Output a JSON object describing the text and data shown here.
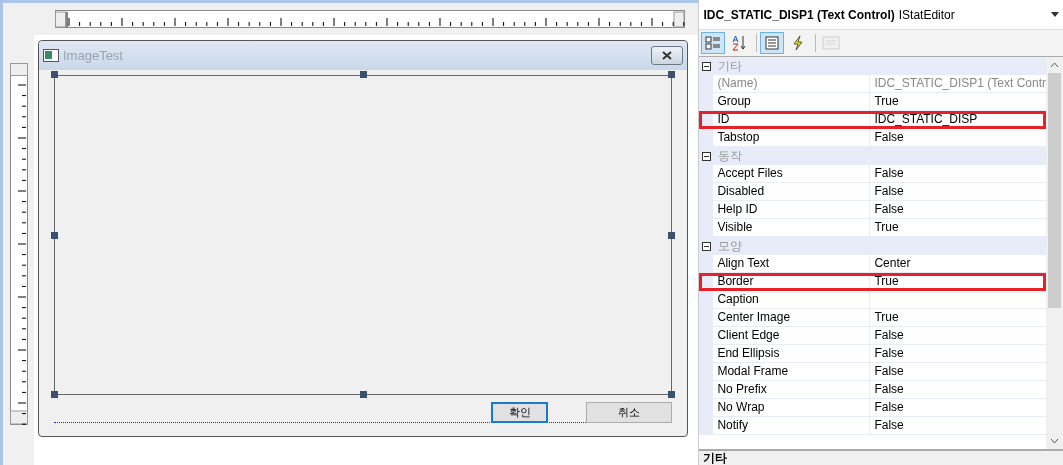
{
  "dialog": {
    "title": "ImageTest",
    "buttons": [
      {
        "label": "확인",
        "focused": true
      },
      {
        "label": "취소",
        "focused": false
      }
    ]
  },
  "property_panel": {
    "object_name": "IDC_STATIC_DISP1 (Text Control)",
    "object_type": "IStatEditor",
    "toolbar": [
      {
        "kind": "categorized",
        "selected": true,
        "disabled": false
      },
      {
        "kind": "alphabetical",
        "selected": false,
        "disabled": false
      },
      {
        "kind": "properties",
        "selected": true,
        "disabled": false
      },
      {
        "kind": "events",
        "selected": false,
        "disabled": false
      },
      {
        "kind": "pages",
        "selected": false,
        "disabled": true
      }
    ],
    "categories": [
      {
        "name": "기타",
        "expanded": true,
        "properties": [
          {
            "name": "(Name)",
            "value": "IDC_STATIC_DISP1 (Text Contr",
            "readonly": true,
            "highlighted": false
          },
          {
            "name": "Group",
            "value": "True",
            "readonly": false,
            "highlighted": false
          },
          {
            "name": "ID",
            "value": "IDC_STATIC_DISP",
            "readonly": false,
            "highlighted": true
          },
          {
            "name": "Tabstop",
            "value": "False",
            "readonly": false,
            "highlighted": false
          }
        ]
      },
      {
        "name": "동작",
        "expanded": true,
        "properties": [
          {
            "name": "Accept Files",
            "value": "False",
            "readonly": false,
            "highlighted": false
          },
          {
            "name": "Disabled",
            "value": "False",
            "readonly": false,
            "highlighted": false
          },
          {
            "name": "Help ID",
            "value": "False",
            "readonly": false,
            "highlighted": false
          },
          {
            "name": "Visible",
            "value": "True",
            "readonly": false,
            "highlighted": false
          }
        ]
      },
      {
        "name": "모양",
        "expanded": true,
        "properties": [
          {
            "name": "Align Text",
            "value": "Center",
            "readonly": false,
            "highlighted": false
          },
          {
            "name": "Border",
            "value": "True",
            "readonly": false,
            "highlighted": true
          },
          {
            "name": "Caption",
            "readonly": false,
            "highlighted": false
          },
          {
            "name": "Center Image",
            "value": "True",
            "readonly": false,
            "highlighted": false
          },
          {
            "name": "Client Edge",
            "value": "False",
            "readonly": false,
            "highlighted": false
          },
          {
            "name": "End Ellipsis",
            "value": "False",
            "readonly": false,
            "highlighted": false
          },
          {
            "name": "Modal Frame",
            "value": "False",
            "readonly": false,
            "highlighted": false
          },
          {
            "name": "No Prefix",
            "value": "False",
            "readonly": false,
            "highlighted": false
          },
          {
            "name": "No Wrap",
            "value": "False",
            "readonly": false,
            "highlighted": false
          },
          {
            "name": "Notify",
            "value": "False",
            "readonly": false,
            "highlighted": false
          }
        ]
      }
    ],
    "description": "기타"
  }
}
